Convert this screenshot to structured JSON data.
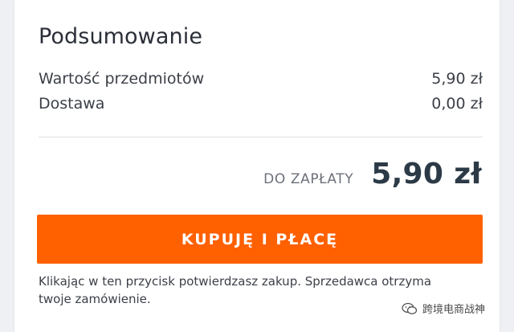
{
  "summary": {
    "title": "Podsumowanie",
    "items_label": "Wartość przedmiotów",
    "items_value": "5,90 zł",
    "delivery_label": "Dostawa",
    "delivery_value": "0,00 zł",
    "total_label": "DO ZAPŁATY",
    "total_value": "5,90 zł"
  },
  "action": {
    "buy_label": "KUPUJĘ I PŁACĘ",
    "note": "Klikając w ten przycisk potwierdzasz zakup. Sprzedawca otrzyma twoje zamówienie."
  },
  "watermark": {
    "text": "跨境电商战神",
    "icon": "wechat-icon"
  },
  "colors": {
    "accent": "#ff6000",
    "total_text": "#2c3a47",
    "background": "#eef0f3"
  }
}
